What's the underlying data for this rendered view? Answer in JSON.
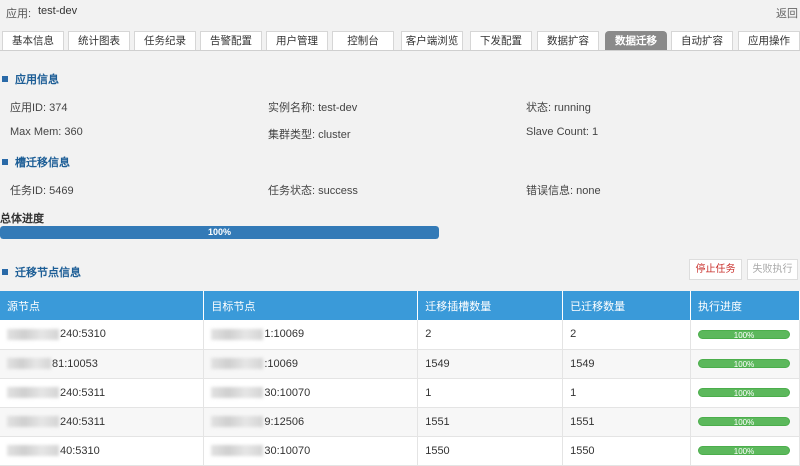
{
  "header": {
    "app_label": "应用:",
    "app_name": "test-dev",
    "back": "返回"
  },
  "tabs": [
    {
      "label": "基本信息",
      "active": false
    },
    {
      "label": "统计图表",
      "active": false
    },
    {
      "label": "任务纪录",
      "active": false
    },
    {
      "label": "告警配置",
      "active": false
    },
    {
      "label": "用户管理",
      "active": false
    },
    {
      "label": "控制台",
      "active": false
    },
    {
      "label": "客户端浏览",
      "active": false
    },
    {
      "label": "下发配置",
      "active": false
    },
    {
      "label": "数据扩容",
      "active": false
    },
    {
      "label": "数据迁移",
      "active": true
    },
    {
      "label": "自动扩容",
      "active": false
    },
    {
      "label": "应用操作",
      "active": false
    }
  ],
  "app_info": {
    "title": "应用信息",
    "app_id": "应用ID: 374",
    "instance_name": "实例名称: test-dev",
    "status": "状态: running",
    "max_mem": "Max Mem: 360",
    "cluster_type": "集群类型: cluster",
    "slave_count": "Slave Count: 1"
  },
  "migration_info": {
    "title": "槽迁移信息",
    "task_id": "任务ID: 5469",
    "task_status": "任务状态: success",
    "error_info": "错误信息: none"
  },
  "overall_progress": {
    "label": "总体进度",
    "value_pct": 100,
    "text": "100%"
  },
  "nodes_section": {
    "title": "迁移节点信息",
    "stop_button": "停止任务",
    "retry_button": "失败执行",
    "columns": [
      "源节点",
      "目标节点",
      "迁移插槽数量",
      "已迁移数量",
      "执行进度"
    ],
    "rows": [
      {
        "source": "240:5310",
        "target": "1:10069",
        "slots": "2",
        "migrated": "2",
        "progress_pct": 100,
        "progress_text": "100%"
      },
      {
        "source": "81:10053",
        "target": ":10069",
        "slots": "1549",
        "migrated": "1549",
        "progress_pct": 100,
        "progress_text": "100%"
      },
      {
        "source": "240:5311",
        "target": "30:10070",
        "slots": "1",
        "migrated": "1",
        "progress_pct": 100,
        "progress_text": "100%"
      },
      {
        "source": "240:5311",
        "target": "9:12506",
        "slots": "1551",
        "migrated": "1551",
        "progress_pct": 100,
        "progress_text": "100%"
      },
      {
        "source": "40:5310",
        "target": "30:10070",
        "slots": "1550",
        "migrated": "1550",
        "progress_pct": 100,
        "progress_text": "100%"
      }
    ]
  },
  "colors": {
    "accent": "#3a9ad9",
    "progress": "#337ab7",
    "success": "#5cb85c",
    "stop": "#c9302c"
  }
}
